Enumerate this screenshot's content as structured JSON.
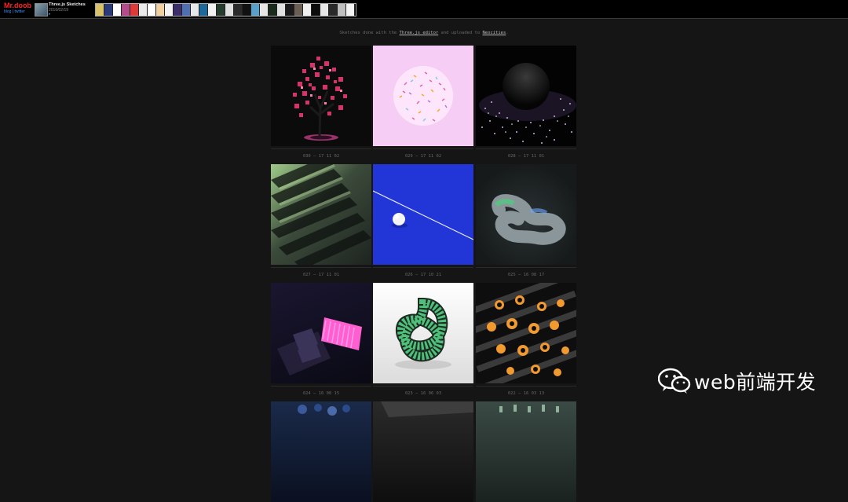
{
  "header": {
    "brand": "Mr.doob",
    "brand_links": "blog | twitter",
    "project_title": "Three.js Sketches",
    "project_date": "2016/02/19",
    "project_link": "▸"
  },
  "projects_strip_colors": [
    "#d9c26a",
    "#2b3b7a",
    "#ffffff",
    "#b34b8c",
    "#dd3a3a",
    "#eaeaea",
    "#ffffff",
    "#f0d0a0",
    "#f4f4f4",
    "#3b2e6b",
    "#4f6fb0",
    "#e8e8e8",
    "#1d6a9a",
    "#f2f2f2",
    "#253c2c",
    "#e0e0e0",
    "#2a2a2a",
    "#111111",
    "#5aa0c8",
    "#e6e6e6",
    "#1b2b1b",
    "#e2e2e2",
    "#1a1a1a",
    "#6a5f52",
    "#f0f0f0",
    "#0c0c0c",
    "#e8e8e8",
    "#2a2a2a",
    "#c0c0c0",
    "#f4f4f4"
  ],
  "intro": {
    "before": "Sketches done with the ",
    "editor_link": "Three.js editor",
    "middle": " and uploaded to ",
    "site_link": "Neocities",
    "after": "."
  },
  "sketches": [
    {
      "caption": "030 — 17 11 02"
    },
    {
      "caption": "029 — 17 11 02"
    },
    {
      "caption": "028 — 17 11 01"
    },
    {
      "caption": "027 — 17 11 01"
    },
    {
      "caption": "026 — 17 10 21"
    },
    {
      "caption": "025 — 16 08 17"
    },
    {
      "caption": "024 — 16 08 15"
    },
    {
      "caption": "023 — 16 06 03"
    },
    {
      "caption": "022 — 16 03 13"
    }
  ],
  "watermark": {
    "text": "web前端开发",
    "icon": "wechat-icon"
  }
}
